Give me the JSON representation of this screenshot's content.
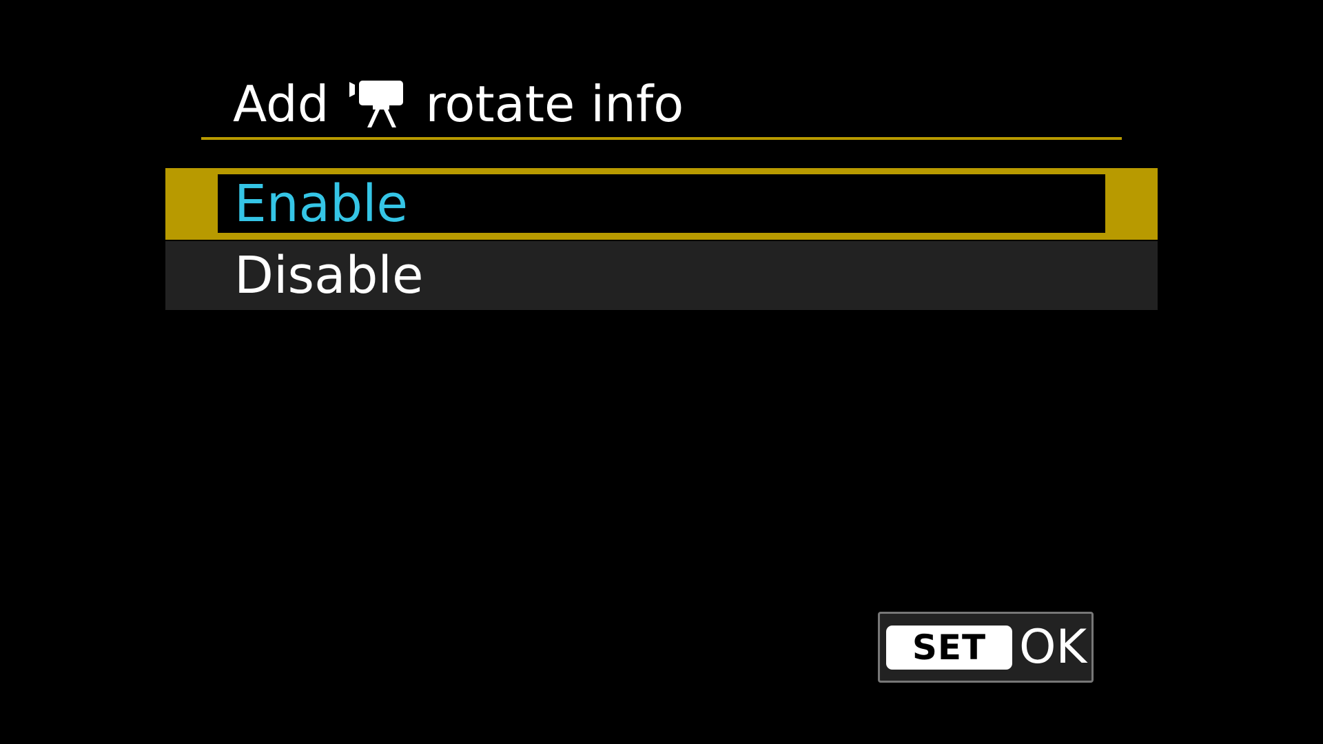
{
  "title": {
    "prefix": "Add",
    "icon": "movie-camera-icon",
    "suffix": "rotate info"
  },
  "options": [
    {
      "label": "Enable",
      "selected": true
    },
    {
      "label": "Disable",
      "selected": false
    }
  ],
  "footer": {
    "set_key": "SET",
    "ok_label": "OK"
  },
  "colors": {
    "background": "#000000",
    "accent_gold": "#b89a00",
    "selected_text": "#35c5e6",
    "unselected_row": "#222222",
    "text": "#ffffff"
  }
}
